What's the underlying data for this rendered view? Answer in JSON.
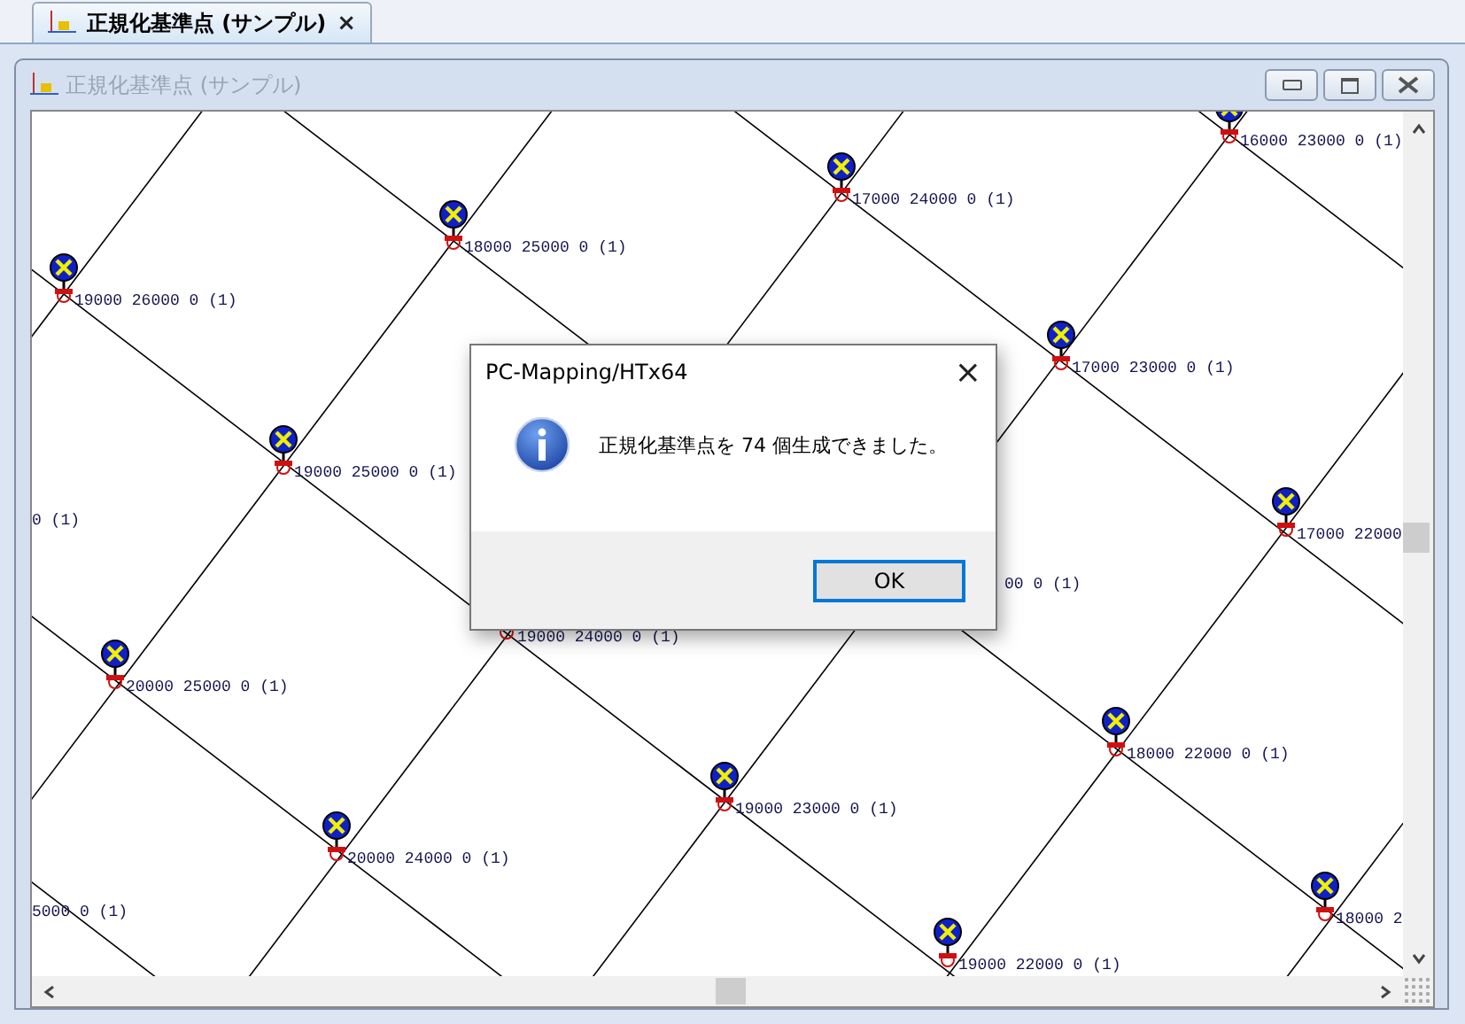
{
  "tab": {
    "label": "正規化基準点 (サンプル)",
    "close": "×",
    "selected": true
  },
  "window": {
    "title": "正規化基準点 (サンプル)",
    "active": false
  },
  "map": {
    "points": [
      {
        "kind": "marker",
        "label": "16000 23000 0 (1)"
      },
      {
        "kind": "marker",
        "label": "17000 24000 0 (1)"
      },
      {
        "kind": "marker",
        "label": "18000 25000 0 (1)"
      },
      {
        "kind": "marker",
        "label": "19000 26000 0 (1)"
      },
      {
        "kind": "marker",
        "label": "17000 23000 0 (1)"
      },
      {
        "kind": "marker",
        "label": "19000 25000 0 (1)"
      },
      {
        "kind": "marker",
        "label": "17000 22000"
      },
      {
        "kind": "text",
        "label": "0 (1)"
      },
      {
        "kind": "marker",
        "label": "19000 24000 0 (1)"
      },
      {
        "kind": "text",
        "label": "00 0 (1)"
      },
      {
        "kind": "marker",
        "label": "20000 25000 0 (1)"
      },
      {
        "kind": "marker",
        "label": "19000 23000 0 (1)"
      },
      {
        "kind": "marker",
        "label": "18000 22000 0 (1)"
      },
      {
        "kind": "marker",
        "label": "20000 24000 0 (1)"
      },
      {
        "kind": "text",
        "label": "5000 0 (1)"
      },
      {
        "kind": "marker",
        "label": "18000 2"
      },
      {
        "kind": "marker",
        "label": "19000 22000 0 (1)"
      }
    ]
  },
  "dialog": {
    "title": "PC-Mapping/HTx64",
    "close": "×",
    "message": "正規化基準点を 74 個生成できました。",
    "button": "OK"
  }
}
